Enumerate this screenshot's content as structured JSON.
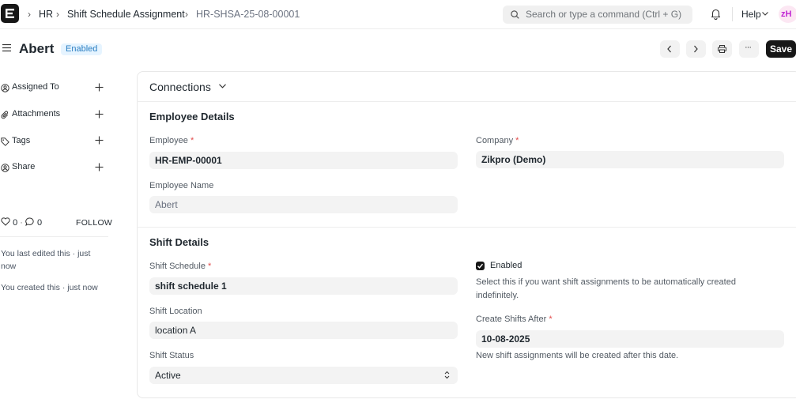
{
  "navbar": {
    "logo_letter": "E",
    "breadcrumbs": [
      "HR",
      "Shift Schedule Assignment",
      "HR-SHSA-25-08-00001"
    ],
    "search_placeholder": "Search or type a command (Ctrl + G)",
    "help_label": "Help",
    "avatar_initials": "zH"
  },
  "page_head": {
    "title": "Abert",
    "status_badge": "Enabled",
    "save_label": "Save",
    "more_label": "···"
  },
  "sidebar": {
    "items": [
      {
        "label": "Assigned To",
        "icon": "user-plus-icon"
      },
      {
        "label": "Attachments",
        "icon": "paperclip-icon"
      },
      {
        "label": "Tags",
        "icon": "tag-icon"
      },
      {
        "label": "Share",
        "icon": "share-icon"
      }
    ],
    "likes_count": "0",
    "comments_count": "0",
    "separator": "·",
    "follow_label": "FOLLOW",
    "activity": [
      "You last edited this · just now",
      "You created this · just now"
    ]
  },
  "form": {
    "connections_label": "Connections",
    "employee_details": {
      "title": "Employee Details",
      "employee_label": "Employee",
      "employee_value": "HR-EMP-00001",
      "company_label": "Company",
      "company_value": "Zikpro (Demo)",
      "employee_name_label": "Employee Name",
      "employee_name_value": "Abert"
    },
    "shift_details": {
      "title": "Shift Details",
      "schedule_label": "Shift Schedule",
      "schedule_value": "shift schedule 1",
      "location_label": "Shift Location",
      "location_value": "location A",
      "status_label": "Shift Status",
      "status_value": "Active",
      "enabled_label": "Enabled",
      "enabled_checked": true,
      "enabled_description": "Select this if you want shift assignments to be automatically created indefinitely.",
      "create_after_label": "Create Shifts After",
      "create_after_value": "10-08-2025",
      "create_after_description": "New shift assignments will be created after this date."
    },
    "required_mark": "*"
  },
  "colors": {
    "accent_dark": "#171717",
    "badge_bg": "#e6f4ff",
    "badge_text": "#2a7ec2",
    "required": "#e24c4c"
  }
}
